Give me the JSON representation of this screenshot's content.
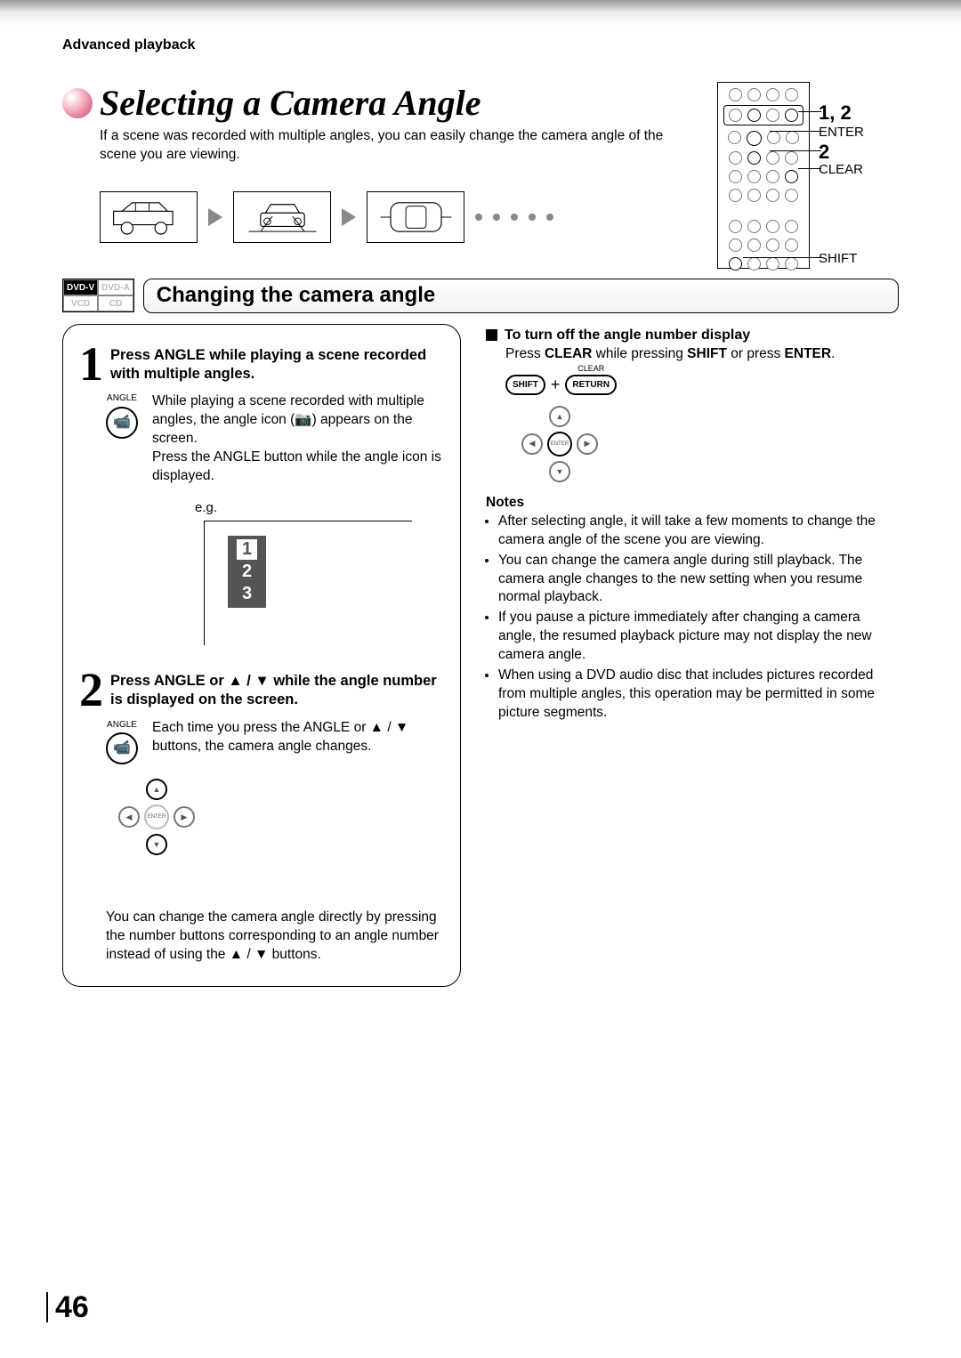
{
  "breadcrumb": "Advanced playback",
  "title": "Selecting a Camera Angle",
  "intro": "If a scene was recorded with multiple angles, you can easily change the camera angle of the scene you are viewing.",
  "remote_labels": {
    "steps12": "1, 2",
    "enter": "ENTER",
    "step2": "2",
    "clear": "CLEAR",
    "shift": "SHIFT"
  },
  "badges": {
    "dvdv": "DVD-V",
    "dvda": "DVD-A",
    "vcd": "VCD",
    "cd": "CD"
  },
  "section_title": "Changing the camera angle",
  "step1": {
    "num": "1",
    "head": "Press ANGLE while playing a scene recorded with multiple angles.",
    "btn_label": "ANGLE",
    "body": "While playing a scene recorded with multiple angles, the angle icon (📷) appears on the screen.",
    "body2": "Press the ANGLE button while the angle icon is displayed.",
    "eg": "e.g.",
    "list": [
      "1",
      "2",
      "3"
    ]
  },
  "step2": {
    "num": "2",
    "head": "Press ANGLE or ▲ / ▼ while the angle number is displayed on the screen.",
    "btn_label": "ANGLE",
    "body": "Each time you press the ANGLE or ▲ / ▼ buttons, the camera angle changes.",
    "center": "ENTER",
    "extra": "You can change the camera angle directly by pressing the number buttons corresponding to an angle number instead of using the ▲ / ▼ buttons."
  },
  "turn_off": {
    "head": "To turn off the angle number display",
    "body_pre": "Press ",
    "clear": "CLEAR",
    "mid": " while pressing ",
    "shift": "SHIFT",
    "mid2": " or press ",
    "enter": "ENTER",
    "end": ".",
    "btn_shift": "SHIFT",
    "btn_return": "RETURN",
    "btn_return_over": "CLEAR",
    "dpad_center": "ENTER"
  },
  "notes_head": "Notes",
  "notes": [
    "After selecting angle, it will take a few moments to change the camera angle of the scene you are viewing.",
    "You can change the camera angle during still playback. The camera angle changes to the new setting when you resume normal playback.",
    "If you pause a picture immediately after changing a camera angle, the resumed playback picture may not display the new camera angle.",
    "When using a DVD audio disc that includes pictures recorded from multiple angles, this operation may be permitted in some picture segments."
  ],
  "page_number": "46"
}
